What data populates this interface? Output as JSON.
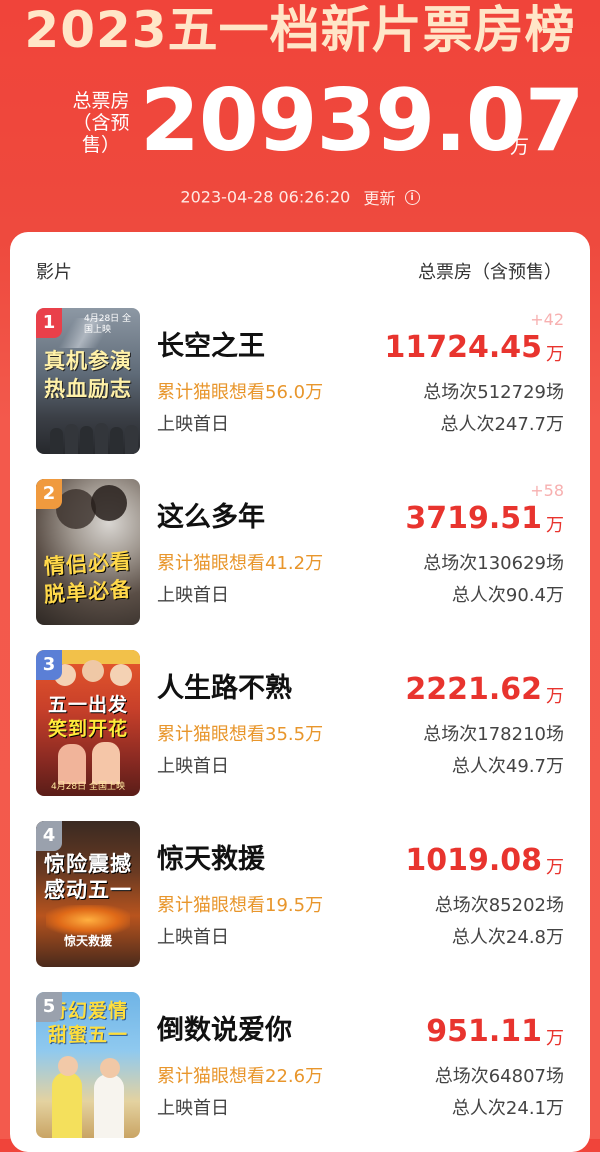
{
  "header": {
    "title": "2023五一档新片票房榜",
    "total_label": "总票房（含预售）",
    "total_value": "20939.07",
    "total_unit": "万",
    "update_time": "2023-04-28  06:26:20",
    "update_label": "更新",
    "info_icon": "i"
  },
  "table": {
    "col_movie": "影片",
    "col_box": "总票房（含预售）"
  },
  "colors": {
    "background": "#f0443a",
    "title_text": "#ffe6c8",
    "box_value": "#e8342e",
    "want_text": "#e8962c",
    "rank1": "#e9404a",
    "rank2": "#f09a3e",
    "rank3": "#5b7fd6",
    "rank_other": "#9aa1ad"
  },
  "movies": [
    {
      "rank": "1",
      "title": "长空之王",
      "want": "累计猫眼想看56.0万",
      "release": "上映首日",
      "delta": "+42",
      "box": "11724.45",
      "unit": "万",
      "shows": "总场次512729场",
      "people": "总人次247.7万",
      "poster_text1": "真机参演",
      "poster_text2": "热血励志",
      "poster_date": "4月28日 全国上映"
    },
    {
      "rank": "2",
      "title": "这么多年",
      "want": "累计猫眼想看41.2万",
      "release": "上映首日",
      "delta": "+58",
      "box": "3719.51",
      "unit": "万",
      "shows": "总场次130629场",
      "people": "总人次90.4万",
      "poster_text1": "情侣必看",
      "poster_text2": "脱单必备"
    },
    {
      "rank": "3",
      "title": "人生路不熟",
      "want": "累计猫眼想看35.5万",
      "release": "上映首日",
      "box": "2221.62",
      "unit": "万",
      "shows": "总场次178210场",
      "people": "总人次49.7万",
      "poster_text1": "五一出发",
      "poster_text2": "笑到开花",
      "poster_date": "4月28日 全国上映"
    },
    {
      "rank": "4",
      "title": "惊天救援",
      "want": "累计猫眼想看19.5万",
      "release": "上映首日",
      "box": "1019.08",
      "unit": "万",
      "shows": "总场次85202场",
      "people": "总人次24.8万",
      "poster_text1": "惊险震撼",
      "poster_text2": "感动五一",
      "poster_sub": "惊天救援"
    },
    {
      "rank": "5",
      "title": "倒数说爱你",
      "want": "累计猫眼想看22.6万",
      "release": "上映首日",
      "box": "951.11",
      "unit": "万",
      "shows": "总场次64807场",
      "people": "总人次24.1万",
      "poster_text1": "奇幻爱情",
      "poster_text2": "甜蜜五一"
    }
  ]
}
